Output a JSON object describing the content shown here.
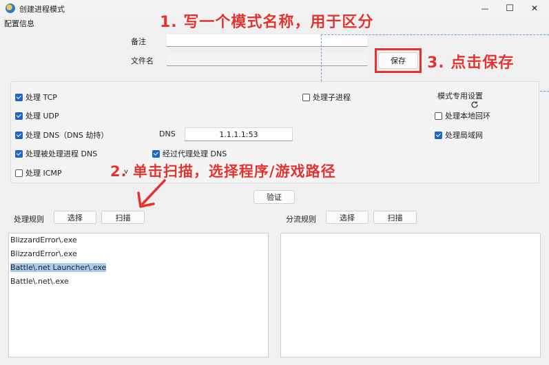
{
  "window": {
    "title": "创建进程模式",
    "minimize_glyph": "—",
    "maximize_glyph": "☐",
    "close_glyph": "✕"
  },
  "menubar": {
    "config_label": "配置信息"
  },
  "form": {
    "remark_label": "备注",
    "remark_value": "",
    "filename_label": "文件名",
    "filename_value": "",
    "save_button": "保存"
  },
  "options": {
    "handle_tcp": {
      "label": "处理 TCP",
      "checked": true
    },
    "handle_udp": {
      "label": "处理 UDP",
      "checked": true
    },
    "handle_dns": {
      "label": "处理 DNS（DNS 劫持）",
      "checked": true
    },
    "handle_by_process_dns": {
      "label": "处理被处理进程 DNS",
      "checked": true
    },
    "handle_icmp": {
      "label": "处理 ICMP",
      "checked": false
    },
    "handle_child_process": {
      "label": "处理子进程",
      "checked": false
    },
    "dns_label": "DNS",
    "dns_value": "1.1.1.1:53",
    "dns_via_proxy": {
      "label": "经过代理处理 DNS",
      "checked": true
    },
    "mode_specific_label": "模式专用设置",
    "handle_loopback": {
      "label": "处理本地回环",
      "checked": false
    },
    "handle_lan": {
      "label": "处理局域网",
      "checked": true
    },
    "icmp_extra": "v"
  },
  "validate_button": "验证",
  "rules": {
    "label": "处理规则",
    "select_button": "选择",
    "scan_button": "扫描",
    "items": [
      "BlizzardError\\.exe",
      "BlizzardError\\.exe",
      "Battle\\.net Launcher\\.exe",
      "Battle\\.net\\.exe"
    ],
    "selected_index": 2
  },
  "split_rules": {
    "label": "分流规则",
    "select_button": "选择",
    "scan_button": "扫描",
    "items": []
  },
  "annotations": {
    "step1": "1. 写一个模式名称，用于区分",
    "step2": "2. 单击扫描，选择程序/游戏路径",
    "step3": "3. 点击保存"
  },
  "colors": {
    "annotation": "#e8312c",
    "checkbox_on": "#1f66c1",
    "selection": "#a9cbee",
    "dashed_guide": "#6a9fdc"
  }
}
